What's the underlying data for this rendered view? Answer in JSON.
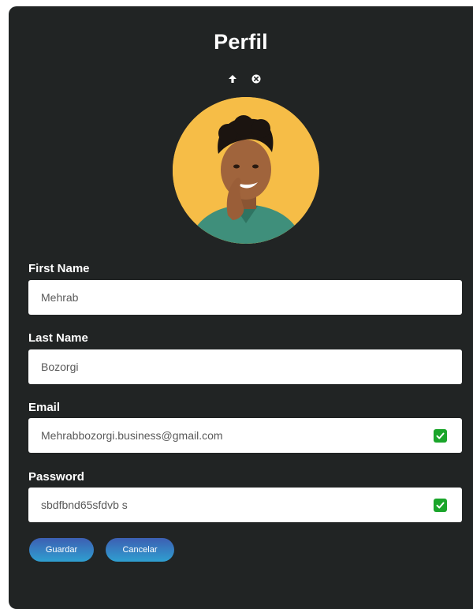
{
  "header": {
    "title": "Perfil",
    "icons": [
      "upload-icon",
      "remove-icon"
    ]
  },
  "fields": {
    "first_name": {
      "label": "First Name",
      "value": "Mehrab"
    },
    "last_name": {
      "label": "Last Name",
      "value": "Bozorgi"
    },
    "email": {
      "label": "Email",
      "value": "Mehrabbozorgi.business@gmail.com",
      "checked": true
    },
    "password": {
      "label": "Password",
      "value": "sbdfbnd65sfdvb s",
      "checked": true
    }
  },
  "actions": {
    "save_label": "Guardar",
    "cancel_label": "Cancelar"
  },
  "colors": {
    "panel_bg": "#212424",
    "avatar_bg": "#f6bd47",
    "check_green": "#1aa52a",
    "button_gradient": [
      "#3d5fb2",
      "#2f9fd0"
    ]
  }
}
